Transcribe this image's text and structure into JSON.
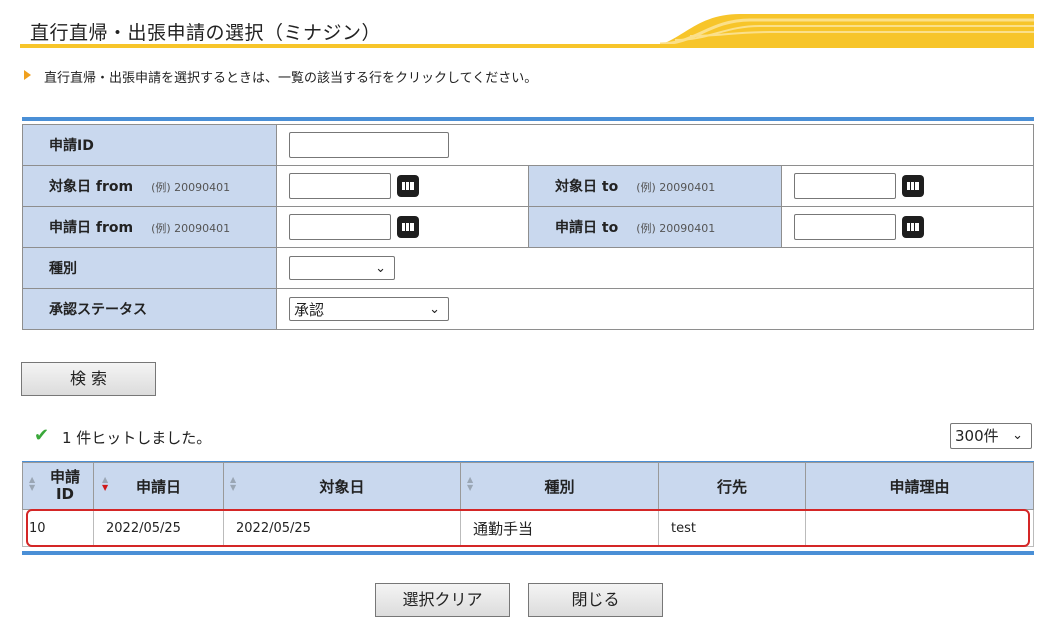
{
  "header": {
    "title": "直行直帰・出張申請の選択（ミナジン）"
  },
  "note": "直行直帰・出張申請を選択するときは、一覧の該当する行をクリックしてください。",
  "form": {
    "request_id_label": "申請ID",
    "target_from_label": "対象日 from",
    "target_to_label": "対象日 to",
    "apply_from_label": "申請日 from",
    "apply_to_label": "申請日 to",
    "example": "(例) 20090401",
    "type_label": "種別",
    "type_value": "",
    "status_label": "承認ステータス",
    "status_value": "承認"
  },
  "search_button": "検 索",
  "results": {
    "hit_text": "1 件ヒットしました。",
    "per_page": "300件",
    "columns": [
      "申請ID",
      "申請日",
      "対象日",
      "種別",
      "行先",
      "申請理由"
    ],
    "rows": [
      {
        "id": "10",
        "apply_date": "2022/05/25",
        "target_date": "2022/05/25",
        "type": "通勤手当",
        "destination": "test",
        "reason": ""
      }
    ]
  },
  "footer": {
    "clear_button": "選択クリア",
    "close_button": "閉じる"
  },
  "colors": {
    "accent_yellow": "#f7c52a",
    "accent_blue": "#4a8fd6",
    "label_bg": "#c9d8ee",
    "highlight": "#d42626"
  }
}
